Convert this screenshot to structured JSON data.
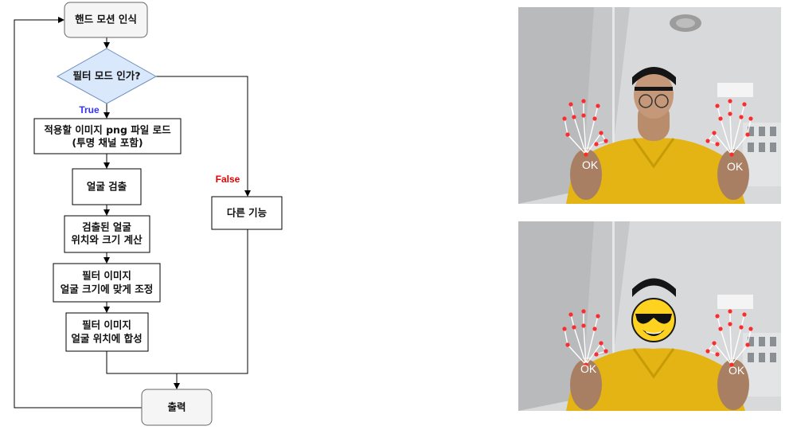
{
  "flowchart": {
    "start": "핸드 모션 인식",
    "decision": "필터 모드 인가?",
    "true_label": "True",
    "false_label": "False",
    "steps": [
      [
        "적용할 이미지 png 파일 로드",
        "(투명 채널 포함)"
      ],
      [
        "얼굴 검출"
      ],
      [
        "검출된 얼굴",
        "위치와 크기 계산"
      ],
      [
        "필터 이미지",
        "얼굴 크기에 맞게 조정"
      ],
      [
        "필터 이미지",
        "얼굴 위치에 합성"
      ]
    ],
    "other": "다른 기능",
    "end": "출력"
  },
  "photos": {
    "top": {
      "left_label": "OK",
      "right_label": "OK"
    },
    "bottom": {
      "left_label": "OK",
      "right_label": "OK"
    }
  },
  "colors": {
    "terminal_fill": "#f5f5f5",
    "decision_fill": "#dae8fc",
    "decision_stroke": "#6c8ebf",
    "true_color": "#3333ff",
    "false_color": "#e60000",
    "shirt": "#e3b414",
    "wall": "#d9dadb",
    "landmark": "#ff2a2a",
    "emoji": "#ffd21f"
  }
}
